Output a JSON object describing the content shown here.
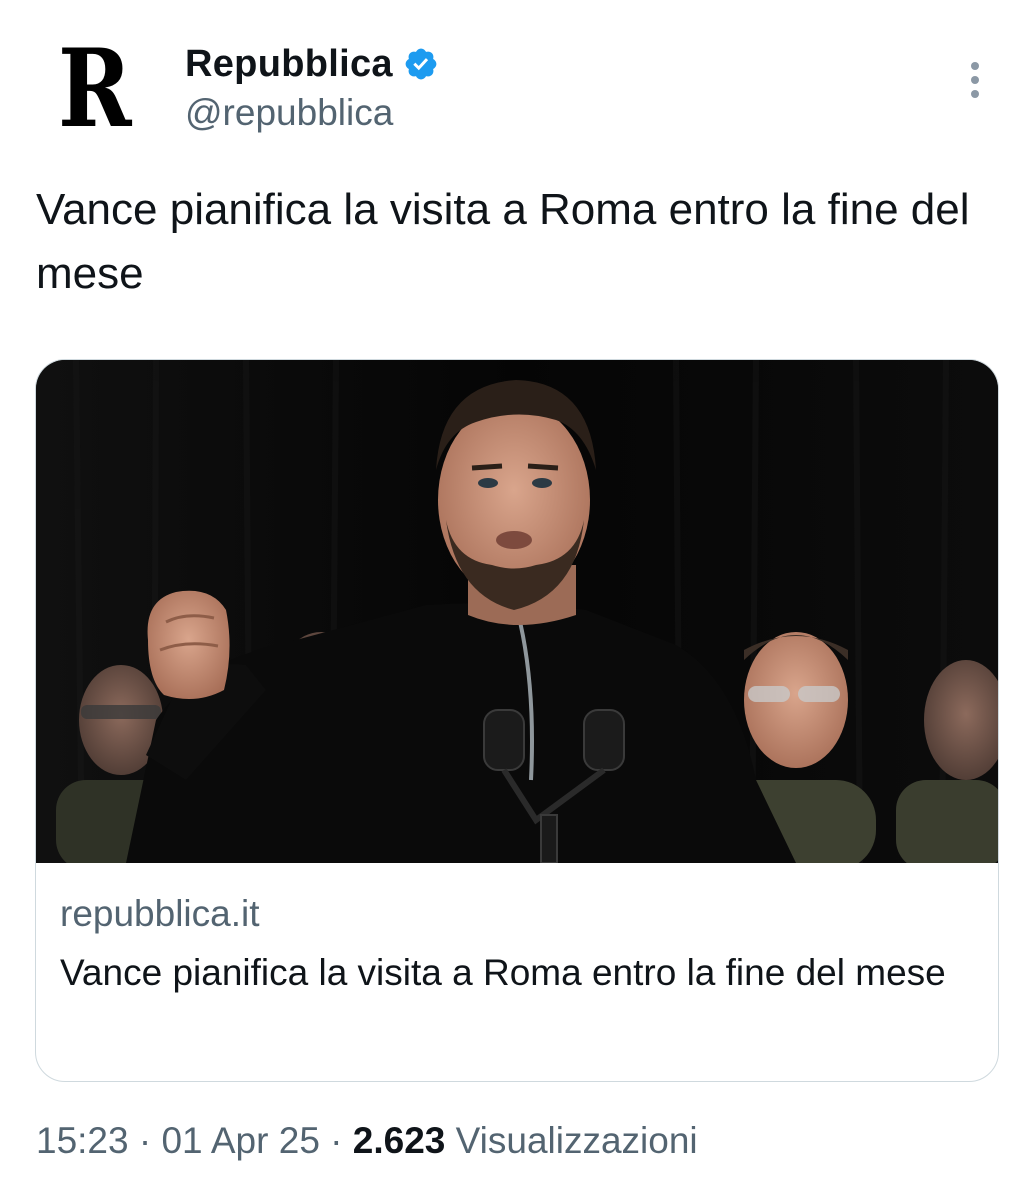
{
  "account": {
    "logo_letter": "R",
    "display_name": "Repubblica",
    "handle": "@repubblica",
    "verified": true,
    "verified_color": "#1d9bf0"
  },
  "tweet": {
    "text": "Vance pianifica la visita a Roma entro la fine del mese"
  },
  "link_card": {
    "image_alt": "photo-jd-vance-speaking-at-podium",
    "domain": "repubblica.it",
    "title": "Vance pianifica la visita a Roma entro la fine del mese"
  },
  "footer": {
    "time": "15:23",
    "separator": "·",
    "date": "01 Apr 25",
    "views_count": "2.623",
    "views_label": "Visualizzazioni"
  },
  "icons": {
    "verified": "verified-badge-icon",
    "more": "more-vertical-icon"
  },
  "colors": {
    "text_primary": "#0f1419",
    "text_secondary": "#536471",
    "border": "#cfd9de"
  }
}
